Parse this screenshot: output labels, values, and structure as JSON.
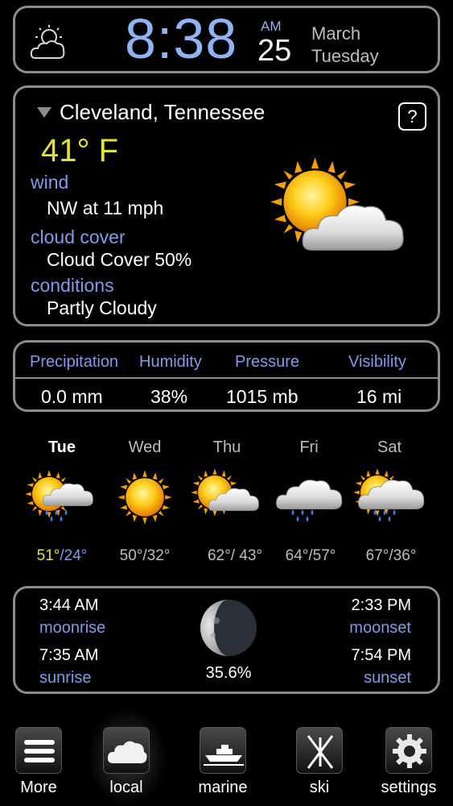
{
  "header": {
    "time": "8:38",
    "ampm": "AM",
    "day_number": "25",
    "month": "March",
    "weekday": "Tuesday",
    "icon": "partly-cloudy-outline-icon"
  },
  "current": {
    "location": "Cleveland, Tennessee",
    "help_label": "?",
    "temperature": "41° F",
    "wind_label": "wind",
    "wind_value": "NW at 11 mph",
    "cloud_label": "cloud cover",
    "cloud_value": "Cloud Cover 50%",
    "conditions_label": "conditions",
    "conditions_value": "Partly Cloudy",
    "icon": "sun-cloud-icon"
  },
  "stats": {
    "headers": [
      "Precipitation",
      "Humidity",
      "Pressure",
      "Visibility"
    ],
    "values": [
      "0.0 mm",
      "38%",
      "1015 mb",
      "16 mi"
    ]
  },
  "forecast": [
    {
      "day": "Tue",
      "high": "51°",
      "low": "/24°",
      "icon": "sun-cloud-rain-icon"
    },
    {
      "day": "Wed",
      "temps": "50°/32°",
      "icon": "sun-icon"
    },
    {
      "day": "Thu",
      "temps": "62°/ 43°",
      "icon": "sun-cloud-icon"
    },
    {
      "day": "Fri",
      "temps": "64°/57°",
      "icon": "cloud-rain-icon"
    },
    {
      "day": "Sat",
      "temps": "67°/36°",
      "icon": "sun-cloud-rain-icon"
    }
  ],
  "astro": {
    "moonrise_time": "3:44 AM",
    "moonrise_label": "moonrise",
    "sunrise_time": "7:35 AM",
    "sunrise_label": "sunrise",
    "moonset_time": "2:33 PM",
    "moonset_label": "moonset",
    "sunset_time": "7:54 PM",
    "sunset_label": "sunset",
    "moon_illumination": "35.6%",
    "moon_icon": "moon-phase-icon"
  },
  "tabs": [
    {
      "label": "More",
      "icon": "menu-icon"
    },
    {
      "label": "local",
      "icon": "cloud-icon"
    },
    {
      "label": "marine",
      "icon": "boat-icon"
    },
    {
      "label": "ski",
      "icon": "ski-icon"
    },
    {
      "label": "settings",
      "icon": "gear-icon"
    }
  ],
  "colors": {
    "accent_blue": "#7f9ce6",
    "temperature_yellow": "#e3e23d",
    "time_blue": "#8fb4f2",
    "border_gray": "#8c8c8c"
  }
}
